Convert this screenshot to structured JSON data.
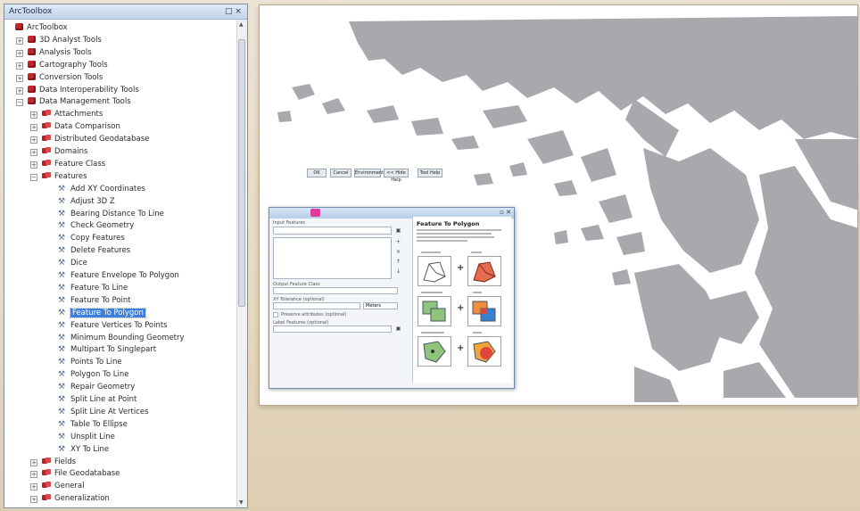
{
  "toolbox": {
    "title": "ArcToolbox",
    "title_controls": "□ ×",
    "root": "ArcToolbox",
    "top_tools": [
      {
        "label": "3D Analyst Tools"
      },
      {
        "label": "Analysis Tools"
      },
      {
        "label": "Cartography Tools"
      },
      {
        "label": "Conversion Tools"
      },
      {
        "label": "Data Interoperability Tools"
      },
      {
        "label": "Data Management Tools"
      }
    ],
    "dm_sets_before": [
      {
        "label": "Attachments"
      },
      {
        "label": "Data Comparison"
      },
      {
        "label": "Distributed Geodatabase"
      },
      {
        "label": "Domains"
      },
      {
        "label": "Feature Class"
      },
      {
        "label": "Features"
      }
    ],
    "feature_tools": [
      {
        "label": "Add XY Coordinates"
      },
      {
        "label": "Adjust 3D Z"
      },
      {
        "label": "Bearing Distance To Line"
      },
      {
        "label": "Check Geometry"
      },
      {
        "label": "Copy Features"
      },
      {
        "label": "Delete Features"
      },
      {
        "label": "Dice"
      },
      {
        "label": "Feature Envelope To Polygon"
      },
      {
        "label": "Feature To Line"
      },
      {
        "label": "Feature To Point"
      },
      {
        "label": "Feature To Polygon"
      },
      {
        "label": "Feature Vertices To Points"
      },
      {
        "label": "Minimum Bounding Geometry"
      },
      {
        "label": "Multipart To Singlepart"
      },
      {
        "label": "Points To Line"
      },
      {
        "label": "Polygon To Line"
      },
      {
        "label": "Repair Geometry"
      },
      {
        "label": "Split Line at Point"
      },
      {
        "label": "Split Line At Vertices"
      },
      {
        "label": "Table To Ellipse"
      },
      {
        "label": "Unsplit Line"
      },
      {
        "label": "XY To Line"
      }
    ],
    "selected_tool": "Feature To Polygon",
    "dm_sets_after": [
      {
        "label": "Fields"
      },
      {
        "label": "File Geodatabase"
      },
      {
        "label": "General"
      },
      {
        "label": "Generalization"
      }
    ]
  },
  "dialog": {
    "field_input_features": "Input Features",
    "field_output": "Output Feature Class",
    "field_xy_tol": "XY Tolerance (optional)",
    "tol_unit": "Meters",
    "field_preserve": "Preserve attributes (optional)",
    "field_label_features": "Label Features (optional)",
    "buttons": {
      "ok": "OK",
      "cancel": "Cancel",
      "environments": "Environments...",
      "hide_help": "<< Hide Help",
      "tool_help": "Tool Help"
    },
    "help_title": "Feature To Polygon"
  },
  "colors": {
    "land": "#a7a9ac",
    "selection": "#3c7fdc",
    "brand_red": "#c0272d"
  },
  "icons": {
    "toolset": "toolset-icon",
    "tool": "tool-hammer-icon",
    "toolbox": "toolbox-icon"
  }
}
